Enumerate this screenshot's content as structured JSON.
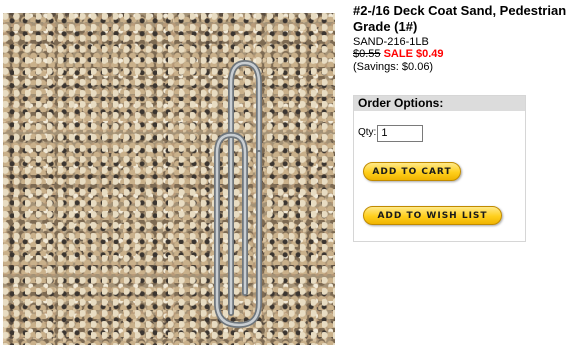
{
  "product": {
    "title": "#2-/16 Deck Coat Sand, Pedestrian Grade (1#)",
    "sku": "SAND-216-1LB",
    "old_price": "$0.55",
    "sale_label": "SALE $0.49",
    "savings": "(Savings: $0.06)"
  },
  "order_options": {
    "header": "Order Options:",
    "qty_label": "Qty:",
    "qty_value": "1",
    "add_to_cart_label": "ADD TO CART",
    "add_to_wishlist_label": "ADD TO WISH LIST"
  },
  "colors": {
    "sale_red": "#ff0000",
    "button_yellow": "#ffcf1c",
    "header_gray": "#dcdcdc"
  }
}
